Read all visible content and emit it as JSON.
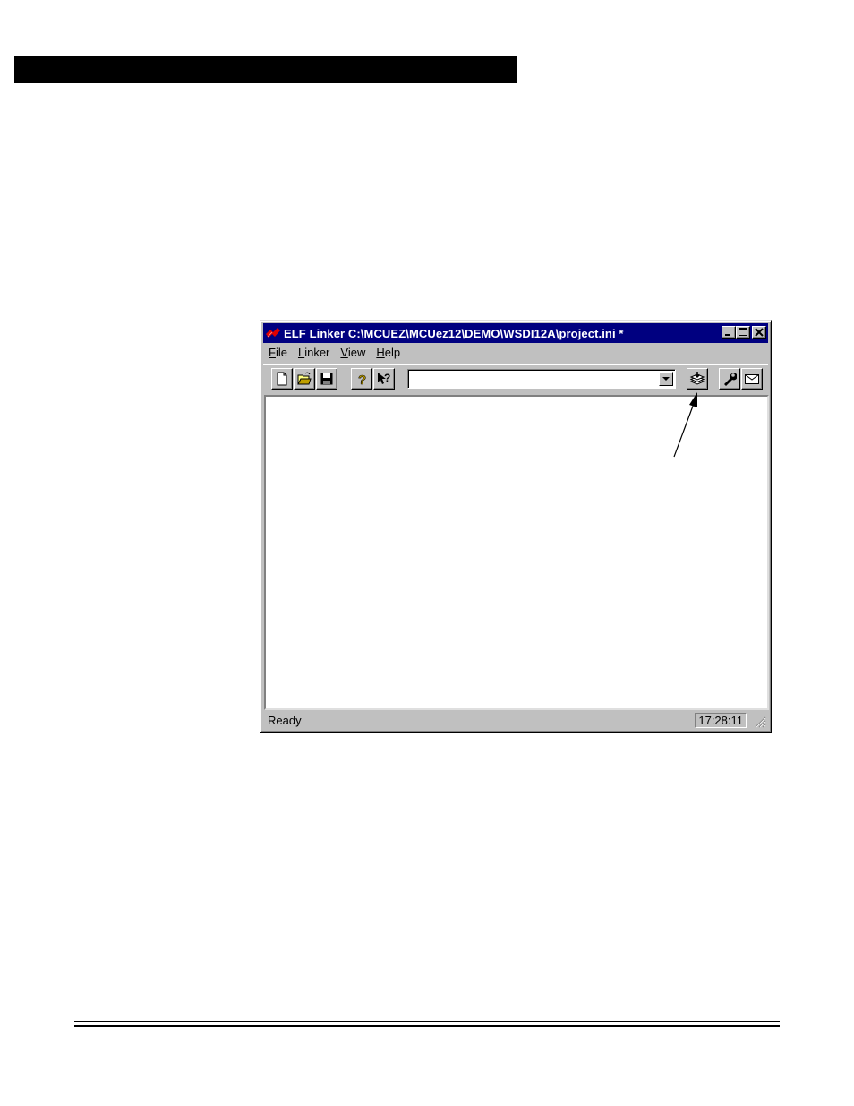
{
  "window": {
    "title": "ELF Linker  C:\\MCUEZ\\MCUez12\\DEMO\\WSDI12A\\project.ini *",
    "controls": {
      "minimize": "_",
      "maximize": "□",
      "close": "✕"
    }
  },
  "menu": {
    "items": [
      {
        "label": "File",
        "accel": "F",
        "rest": "ile"
      },
      {
        "label": "Linker",
        "accel": "L",
        "rest": "inker"
      },
      {
        "label": "View",
        "accel": "V",
        "rest": "iew"
      },
      {
        "label": "Help",
        "accel": "H",
        "rest": "elp"
      }
    ]
  },
  "toolbar": {
    "buttons": [
      "new-file-icon",
      "open-folder-icon",
      "save-disk-icon",
      "help-icon",
      "context-help-icon",
      "link-icon",
      "options-wrench-icon",
      "message-envelope-icon"
    ],
    "combo_value": ""
  },
  "status": {
    "text": "Ready",
    "time": "17:28:11"
  },
  "colors": {
    "titlebar": "#000080",
    "face": "#c0c0c0"
  }
}
